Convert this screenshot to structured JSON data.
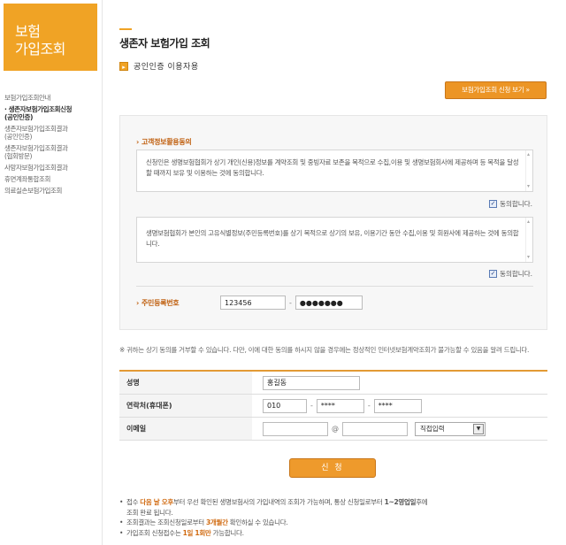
{
  "sidebar": {
    "brand_line1": "보험",
    "brand_line2": "가입조회",
    "items": [
      {
        "label": "보험가입조회안내"
      },
      {
        "label": "생존자보험가입조회신청",
        "sub": "(공인인증)"
      },
      {
        "label": "생존자보험가입조회결과",
        "sub": "(공인인증)"
      },
      {
        "label": "생존자보험가입조회결과",
        "sub": "(협회방문)"
      },
      {
        "label": "사망자보험가입조회결과"
      },
      {
        "label": "휴면계좌통합조회"
      },
      {
        "label": "의료실손보험가입조회"
      }
    ]
  },
  "main": {
    "title": "생존자 보험가입 조회",
    "cert_label": "공인인증 이용자용",
    "guide_button": "보험가입조회 신청 보기 »",
    "consent_section": "고객정보활용동의",
    "consent1_text": "신청인은 생명보험협회가 상기 개인(신용)정보를 계약조회 및 중빙자료 보존을 목적으로 수집,이용 및 생명보험회사에 제공하며 등 목적을 달성할 때까지 보유 및 이용하는 것에 동의합니다.",
    "consent2_text": "생명보험협회가 본인의 고유식별정보(주민등록번호)를 상기 목적으로 상기의 보유, 이용기간 동안 수집,이용 및 회원사에 제공하는 것에 동의합니다.",
    "agree_label": "동의합니다.",
    "id_label": "주민등록번호",
    "id_front": "123456",
    "id_back": "●●●●●●●",
    "notice": "※ 귀하는 상기 동의를 거부할 수 있습니다. 다만, 이에 대한 동의를 하시지 않을 경우에는 정상적인 인터넷보험계약조회가 불가능할 수 있음을 알려 드립니다.",
    "form": {
      "name_label": "성명",
      "name_value": "홍길동",
      "phone_label": "연락처(휴대폰)",
      "phone1": "010",
      "phone2": "****",
      "phone3": "****",
      "email_label": "이메일",
      "email_at": "@",
      "email_select": "직접입력"
    },
    "submit_label": "신 청",
    "notes": {
      "n1_a": "접수 ",
      "n1_hl": "다음 날 오후",
      "n1_b": "부터 우선 확인된 생명보험사의 가입내역의 조회가 가능하며, 통상 신청일로부터 ",
      "n1_bold": "1~2영업일",
      "n1_c": "후에",
      "n1_d": "조회 완료 됩니다.",
      "n2_a": "조회결과는 조회신청일로부터 ",
      "n2_hl": "3개월간",
      "n2_b": " 확인하실 수 있습니다.",
      "n3_a": "가입조회 신청접수는 ",
      "n3_bold": "1일 1회만",
      "n3_b": " 가능합니다."
    }
  }
}
